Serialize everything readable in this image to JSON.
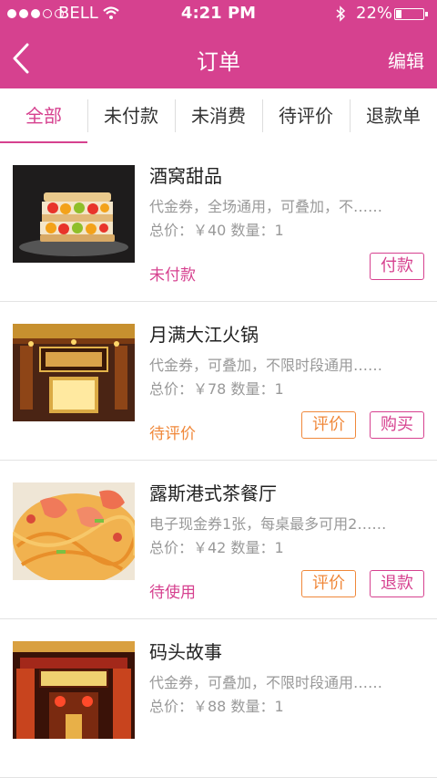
{
  "status_bar": {
    "carrier": "BELL",
    "time": "4:21 PM",
    "battery": "22%",
    "battery_level": 0.22
  },
  "nav": {
    "title": "订单",
    "action": "编辑"
  },
  "tabs": [
    "全部",
    "未付款",
    "未消费",
    "待评价",
    "退款单"
  ],
  "orders": [
    {
      "title": "酒窝甜品",
      "desc": "代金券，全场通用，可叠加，不……",
      "price": "总价：￥40   数量：1",
      "status": "未付款",
      "status_color": "#d6418f",
      "buttons": [
        "付款"
      ]
    },
    {
      "title": "月满大江火锅",
      "desc": "代金券，可叠加，不限时段通用……",
      "price": "总价：￥78   数量：1",
      "status": "待评价",
      "status_color": "#f0883a",
      "buttons": [
        "评价",
        "购买"
      ]
    },
    {
      "title": "露斯港式茶餐厅",
      "desc": "电子现金券1张，每桌最多可用2……",
      "price": "总价：￥42   数量：1",
      "status": "待使用",
      "status_color": "#d6418f",
      "buttons": [
        "评价",
        "退款"
      ]
    },
    {
      "title": "码头故事",
      "desc": "代金券，可叠加，不限时段通用……",
      "price": "总价：￥88   数量：1",
      "status": "",
      "status_color": "#d6418f",
      "buttons": []
    }
  ],
  "colors": {
    "brand": "#d6418f",
    "accent": "#f0883a"
  }
}
